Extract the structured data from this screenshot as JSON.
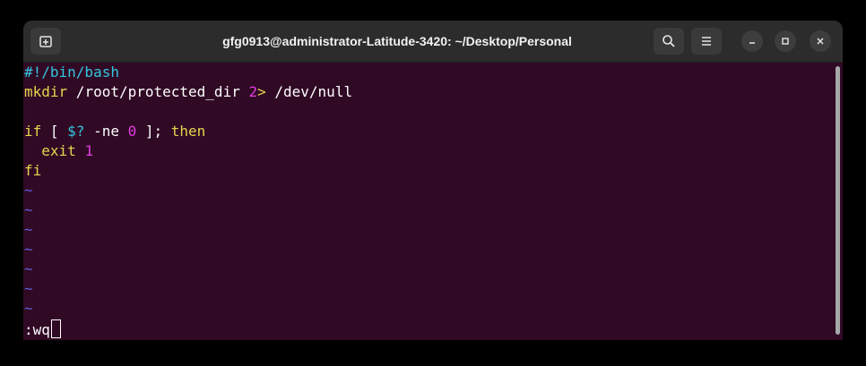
{
  "window": {
    "title": "gfg0913@administrator-Latitude-3420: ~/Desktop/Personal"
  },
  "icons": {
    "new_tab": "new-tab-icon",
    "search": "search-icon",
    "menu": "hamburger-menu-icon",
    "minimize": "minimize-icon",
    "maximize": "maximize-icon",
    "close": "close-icon"
  },
  "colors": {
    "terminal_bg": "#300a24",
    "titlebar_bg": "#2c2c2c",
    "keyword": "#e8d44d",
    "shebang": "#34c6e0",
    "number": "#e23be0",
    "tilde": "#5a5fd8"
  },
  "editor": {
    "line1": {
      "text": "#!/bin/bash"
    },
    "line2": {
      "cmd": "mkdir",
      "arg": " /root/protected_dir ",
      "num": "2",
      "op": ">",
      "rest": " /dev/null"
    },
    "line4": {
      "kw_if": "if",
      "p1": " [ ",
      "var": "$?",
      "p2": " -ne ",
      "num": "0",
      "p3": " ]; ",
      "kw_then": "then"
    },
    "line5": {
      "indent": "  ",
      "kw": "exit",
      "sp": " ",
      "num": "1"
    },
    "line6": {
      "kw": "fi"
    },
    "tilde": "~",
    "command_line": ":wq"
  }
}
